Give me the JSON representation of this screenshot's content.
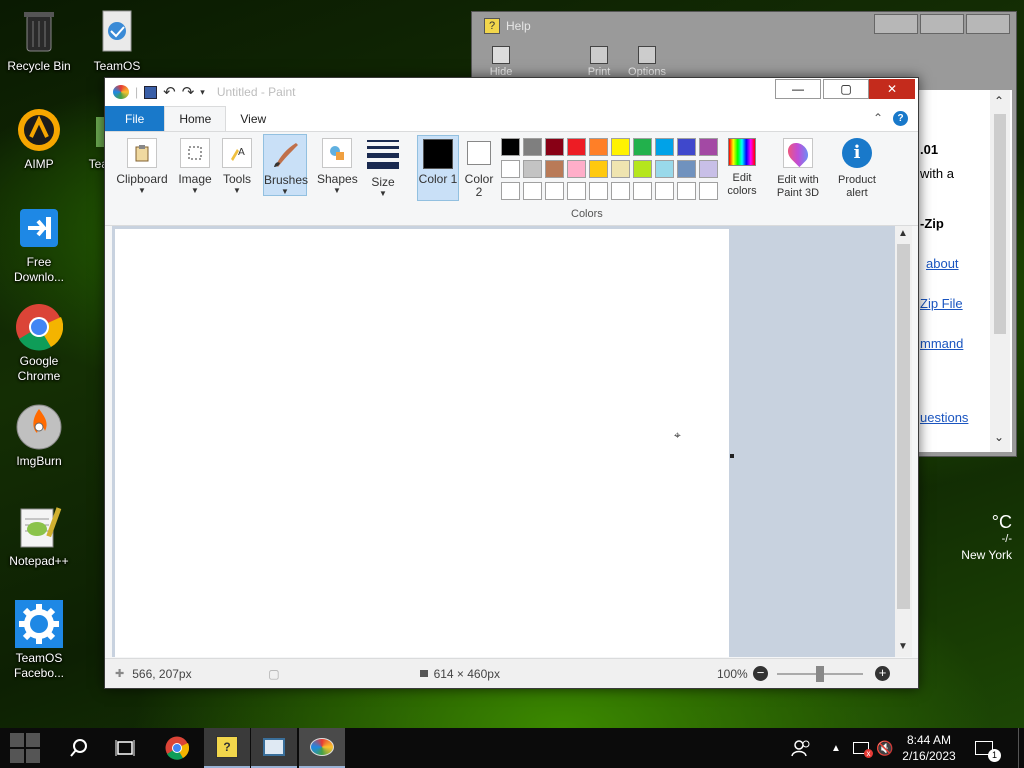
{
  "desktop": {
    "icons": [
      {
        "name": "recycle-bin",
        "label": "Recycle Bin"
      },
      {
        "name": "teamos",
        "label": "TeamOS"
      },
      {
        "name": "aimp",
        "label": "AIMP"
      },
      {
        "name": "teamos-partial",
        "label": "Tea"
      },
      {
        "name": "free-download",
        "label": "Free Downlo..."
      },
      {
        "name": "google-chrome",
        "label": "Google Chrome"
      },
      {
        "name": "imgburn",
        "label": "ImgBurn"
      },
      {
        "name": "notepadpp",
        "label": "Notepad++"
      },
      {
        "name": "teamos-facebook",
        "label": "TeamOS Facebo..."
      }
    ]
  },
  "help_window": {
    "title": "Help",
    "toolbar": [
      "Hide",
      "Print",
      "Options"
    ],
    "content": {
      "fragment1": ".01",
      "fragment2": "with a",
      "fragment3": "-Zip",
      "link1": "about",
      "link2": "Zip File",
      "link3": "mmand",
      "link4": "uestions"
    }
  },
  "paint": {
    "title": "Untitled - Paint",
    "tabs": {
      "file": "File",
      "home": "Home",
      "view": "View"
    },
    "ribbon": {
      "clipboard": "Clipboard",
      "image": "Image",
      "tools": "Tools",
      "brushes": "Brushes",
      "shapes": "Shapes",
      "size": "Size",
      "color1": "Color 1",
      "color2": "Color 2",
      "edit_colors": "Edit colors",
      "edit_paint3d": "Edit with Paint 3D",
      "product_alert": "Product alert",
      "colors_group": "Colors"
    },
    "palette_row1": [
      "#000000",
      "#7f7f7f",
      "#880015",
      "#ed1c24",
      "#ff7f27",
      "#fff200",
      "#22b14c",
      "#00a2e8",
      "#3f48cc",
      "#a349a4"
    ],
    "palette_row2": [
      "#ffffff",
      "#c3c3c3",
      "#b97a57",
      "#ffaec9",
      "#ffc90e",
      "#efe4b0",
      "#b5e61d",
      "#99d9ea",
      "#7092be",
      "#c8bfe7"
    ],
    "status": {
      "cursor": "566, 207px",
      "size": "614 × 460px",
      "zoom": "100%"
    }
  },
  "weather": {
    "temp_unit": "°C",
    "dash": "-/-",
    "city": "New York"
  },
  "taskbar": {
    "time": "8:44 AM",
    "date": "2/16/2023",
    "notification_count": "1"
  }
}
